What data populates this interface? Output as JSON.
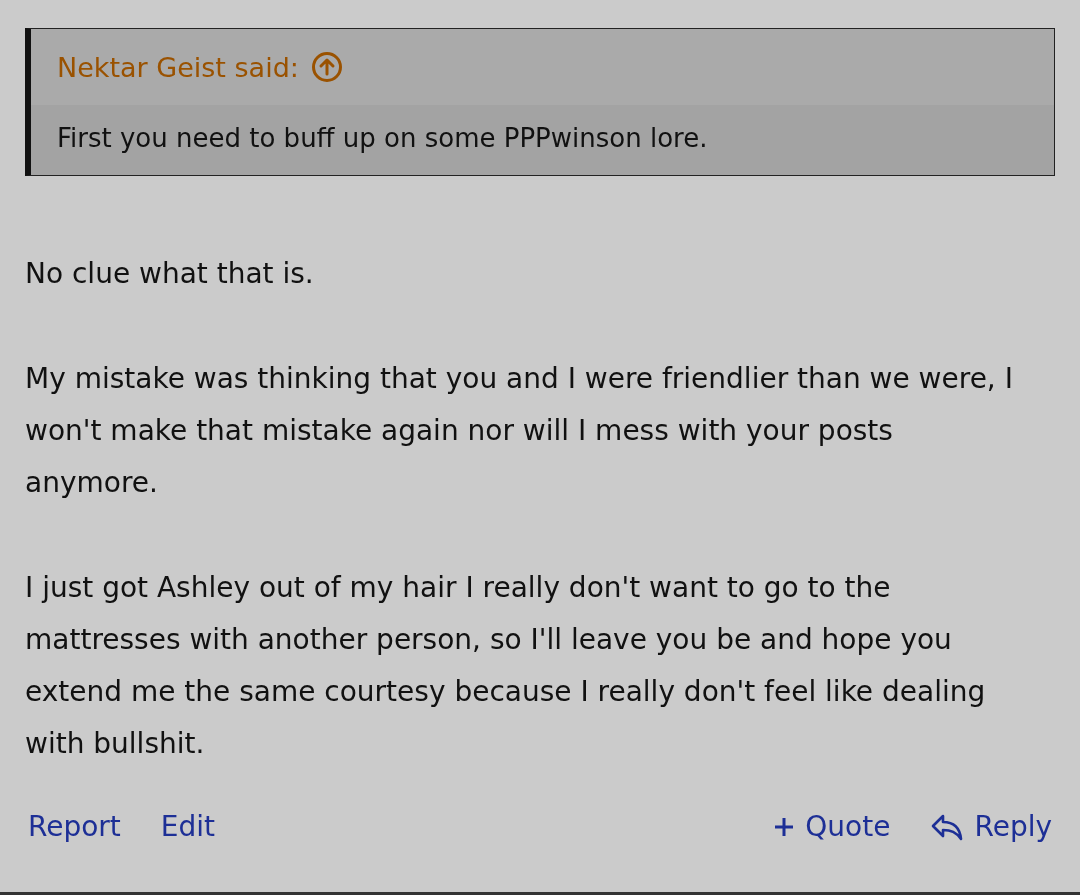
{
  "quote": {
    "attribution": "Nektar Geist said:",
    "text": "First you need to buff up on some PPPwinson lore."
  },
  "paragraphs": [
    "No clue what that is.",
    "My mistake was thinking that you and I were friendlier than we were, I won't make that mistake again nor will I mess with your posts anymore.",
    "I just got Ashley out of my hair I really don't want to go to the mattresses with another person, so I'll leave you be and hope you extend me the same courtesy because I really don't feel like dealing with bullshit."
  ],
  "actions_left": [
    "Report",
    "Edit"
  ],
  "actions_right": [
    {
      "label": "Quote",
      "kind": "plus"
    },
    {
      "label": "Reply",
      "kind": "reply"
    }
  ]
}
